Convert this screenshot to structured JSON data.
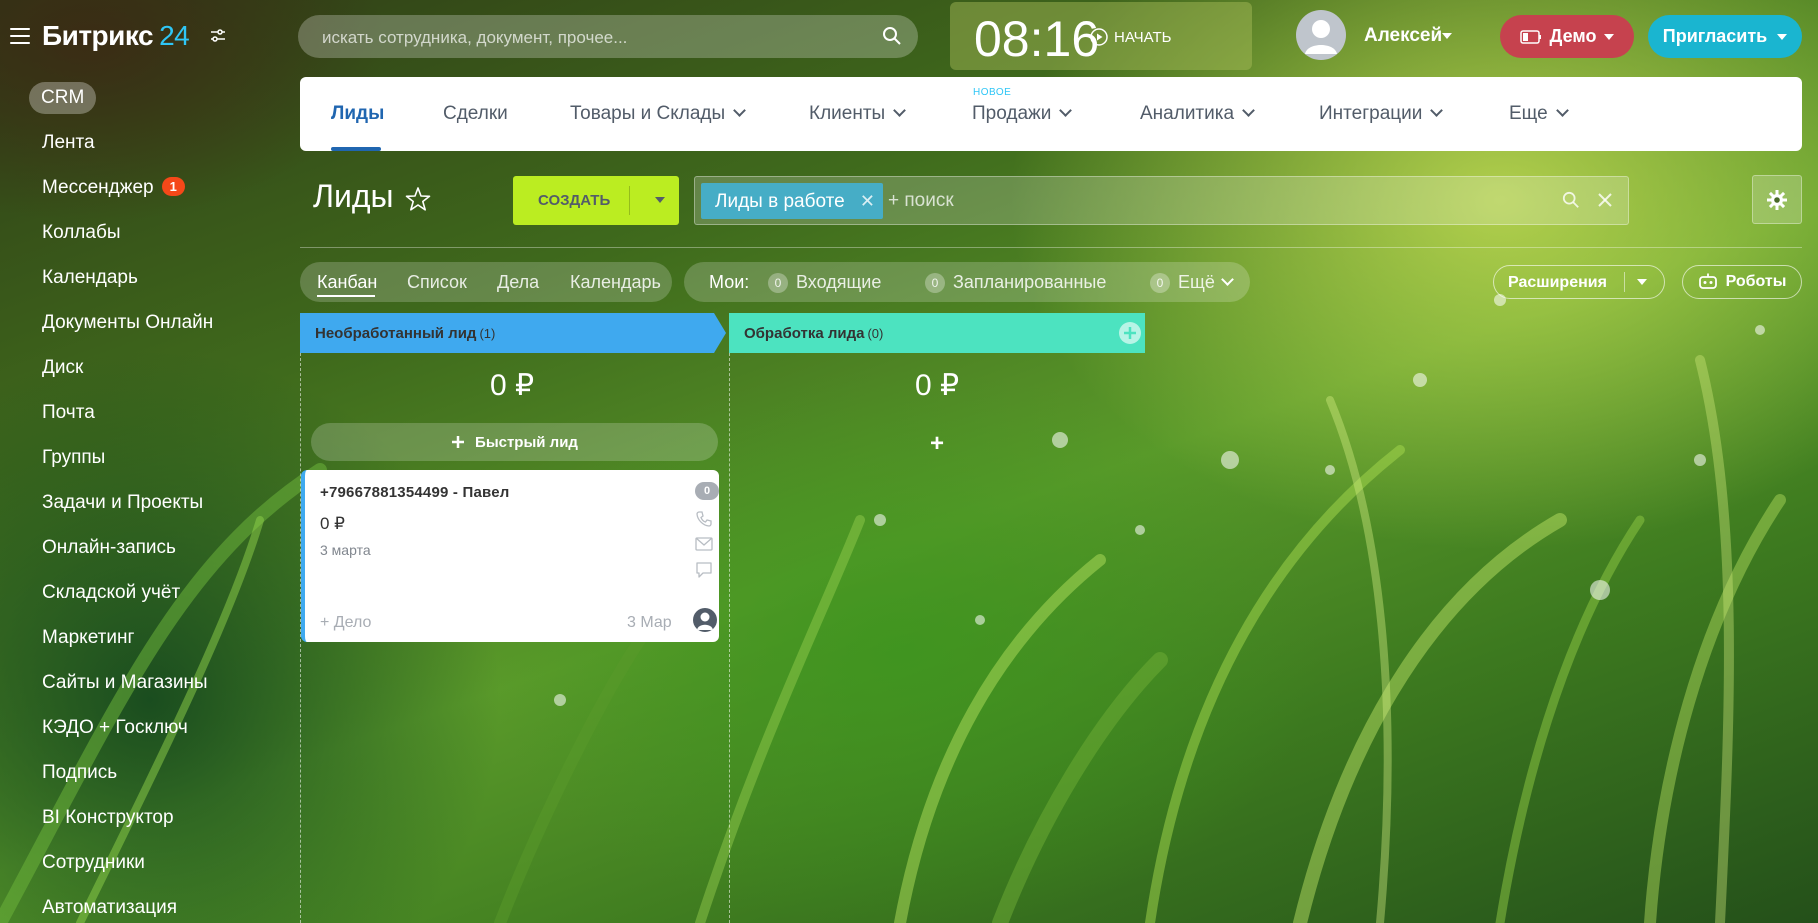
{
  "header": {
    "logo_text": "Битрикс",
    "logo_number": "24",
    "search_placeholder": "искать сотрудника, документ, прочее...",
    "clock_time": "08:16",
    "clock_start_label": "НАЧАТЬ",
    "user_name": "Алексей",
    "demo_label": "Демо",
    "invite_label": "Пригласить"
  },
  "sidebar": {
    "crm_label": "CRM",
    "items": [
      {
        "label": "Лента"
      },
      {
        "label": "Мессенджер",
        "badge": "1"
      },
      {
        "label": "Коллабы"
      },
      {
        "label": "Календарь"
      },
      {
        "label": "Документы Онлайн"
      },
      {
        "label": "Диск"
      },
      {
        "label": "Почта"
      },
      {
        "label": "Группы"
      },
      {
        "label": "Задачи и Проекты"
      },
      {
        "label": "Онлайн-запись"
      },
      {
        "label": "Складской учёт"
      },
      {
        "label": "Маркетинг"
      },
      {
        "label": "Сайты и Магазины"
      },
      {
        "label": "КЭДО + Госключ"
      },
      {
        "label": "Подпись"
      },
      {
        "label": "BI Конструктор"
      },
      {
        "label": "Сотрудники"
      },
      {
        "label": "Автоматизация"
      }
    ]
  },
  "topnav": {
    "new_label": "НОВОЕ",
    "tabs": [
      {
        "label": "Лиды"
      },
      {
        "label": "Сделки"
      },
      {
        "label": "Товары и Склады"
      },
      {
        "label": "Клиенты"
      },
      {
        "label": "Продажи"
      },
      {
        "label": "Аналитика"
      },
      {
        "label": "Интеграции"
      },
      {
        "label": "Еще"
      }
    ]
  },
  "toolbar": {
    "page_title": "Лиды",
    "create_label": "СОЗДАТЬ",
    "filter_chip": "Лиды в работе",
    "search_hint": "+ поиск"
  },
  "views": {
    "items": [
      {
        "label": "Канбан"
      },
      {
        "label": "Список"
      },
      {
        "label": "Дела"
      },
      {
        "label": "Календарь"
      }
    ]
  },
  "counters": {
    "title": "Мои:",
    "items": [
      {
        "count": "0",
        "label": "Входящие"
      },
      {
        "count": "0",
        "label": "Запланированные"
      },
      {
        "count": "0",
        "label": "Ещё"
      }
    ]
  },
  "actions": {
    "extensions_label": "Расширения",
    "robots_label": "Роботы"
  },
  "kanban": {
    "columns": [
      {
        "title": "Необработанный лид",
        "count": "(1)",
        "sum": "0 ₽",
        "color": "#3fa9ef"
      },
      {
        "title": "Обработка лида",
        "count": "(0)",
        "sum": "0 ₽",
        "color": "#4ce3c0"
      }
    ],
    "quick_lead_label": "Быстрый лид",
    "add_symbol": "+",
    "card": {
      "title": "+79667881354499 - Павел",
      "amount": "0 ₽",
      "date": "3 марта",
      "activity_count": "0",
      "add_activity": "+ Дело",
      "activity_date": "3 Мар"
    }
  },
  "colors": {
    "accent_blue": "#2066b0",
    "create_green": "#bbed21",
    "demo_red": "#c6424e",
    "invite_cyan": "#1ab5d0",
    "badge_orange": "#f54819"
  }
}
